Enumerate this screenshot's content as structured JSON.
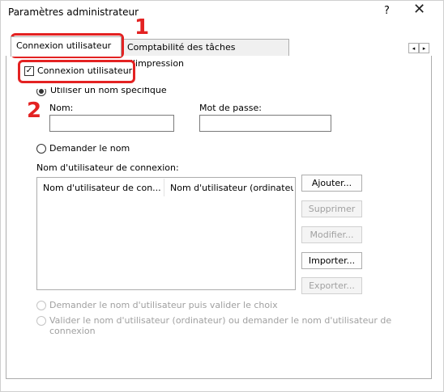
{
  "window": {
    "title": "Paramètres administrateur",
    "help_label": "?",
    "close_label": "✕"
  },
  "tabs": [
    {
      "label": "Connexion utilisateur",
      "active": true
    },
    {
      "label": "Comptabilité des tâches d'impression",
      "active": false
    }
  ],
  "scroll": {
    "left": "◂",
    "right": "▸"
  },
  "login": {
    "checkbox_label": "Connexion utilisateur",
    "checkbox_mark": "✓",
    "checked": true,
    "specific_name_label": "Utiliser un nom spécifique",
    "name_label": "Nom:",
    "password_label": "Mot de passe:",
    "name_value": "",
    "password_value": "",
    "prompt_name_label": "Demander le nom",
    "list_title": "Nom d'utilisateur de connexion:",
    "columns": [
      "Nom d'utilisateur de con...",
      "Nom d'utilisateur (ordinateu"
    ],
    "rows": []
  },
  "buttons": {
    "add": "Ajouter...",
    "delete": "Supprimer",
    "edit": "Modifier...",
    "import": "Importer...",
    "export": "Exporter..."
  },
  "options": {
    "prompt_validate": "Demander le nom d'utilisateur puis valider le choix",
    "validate_or_prompt_line1": "Valider le nom d'utilisateur (ordinateur) ou demander le nom d'utilisateur de",
    "validate_or_prompt_line2": "connexion"
  },
  "callouts": {
    "one": "1",
    "two": "2"
  },
  "colors": {
    "highlight": "#e32222"
  }
}
